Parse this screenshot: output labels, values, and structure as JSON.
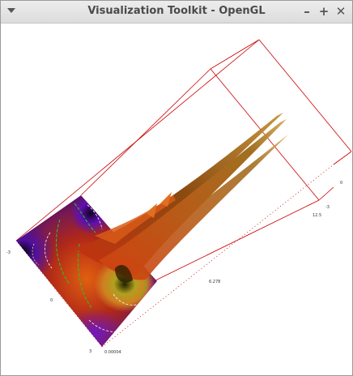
{
  "window": {
    "title": "Visualization Toolkit - OpenGL",
    "controls": {
      "minimize": "–",
      "maximize": "+",
      "close": "✕"
    },
    "menu_icon": "chevron-down-icon"
  },
  "colors": {
    "frame": "#cc0000",
    "contour_green": "#22cc22",
    "contour_white": "#ffffff",
    "surface_low": "#3a0060",
    "surface_mid": "#c04010",
    "surface_high": "#d2a040"
  },
  "axis_labels": {
    "left_neg": "-3",
    "left_zero": "0",
    "bottom_pos": "3",
    "bottom_value": "0.00004",
    "x_mid": "6.278",
    "right_value": "12.5",
    "right_neg": "-3",
    "right_zero": "0"
  }
}
